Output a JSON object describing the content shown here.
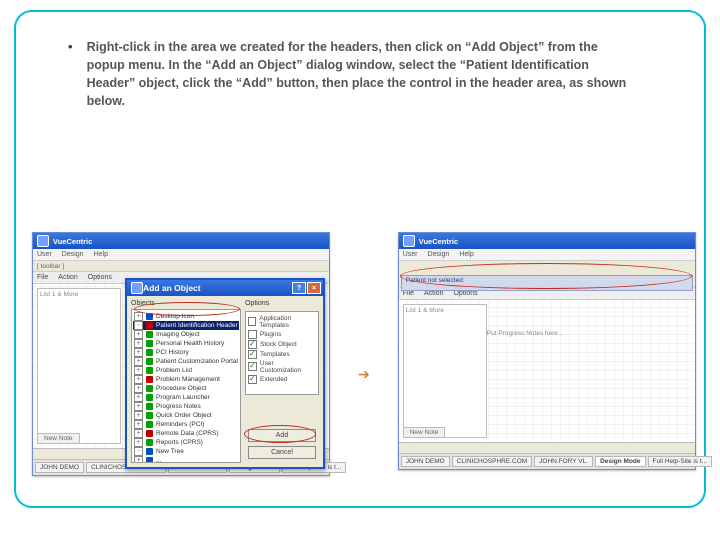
{
  "bullet": "•",
  "intro": "Right-click in the area we created for the headers, then click on “Add Object” from the popup menu.  In the “Add an Object” dialog window, select the “Patient Identification Header” object, click the “Add” button, then place the control in the header area, as shown below.",
  "arrow_glyph": "➔",
  "app_title": "VueCentric",
  "main_menu": {
    "0": "User",
    "1": "Design",
    "2": "Help"
  },
  "toolbar": {
    "0": "File",
    "1": "Action",
    "2": "Options"
  },
  "side_note": "List 1 & More",
  "tabs": {
    "0": "JOHN DEMO",
    "1": "CLINICHOSPHRE.COM",
    "2": "JOHN.FORY VL.",
    "3": "Design Mode",
    "4": "Full Help-Site is t..."
  },
  "dialog": {
    "title": "Add an Object",
    "section_objects": "Objects",
    "items": [
      {
        "pm": "+",
        "cls": "ib",
        "label": "Desktop Icon"
      },
      {
        "pm": "-",
        "cls": "ir",
        "label": "Patient Identification Header",
        "sel": true
      },
      {
        "pm": "+",
        "cls": "ig",
        "label": "Imaging Object"
      },
      {
        "pm": "+",
        "cls": "ig",
        "label": "Personal Health History"
      },
      {
        "pm": "+",
        "cls": "ig",
        "label": "PCI History"
      },
      {
        "pm": "+",
        "cls": "ig",
        "label": "Patient Customization Portal"
      },
      {
        "pm": "+",
        "cls": "ig",
        "label": "Problem List"
      },
      {
        "pm": "+",
        "cls": "ir",
        "label": "Problem Management"
      },
      {
        "pm": "+",
        "cls": "ig",
        "label": "Procedure Object"
      },
      {
        "pm": "+",
        "cls": "ig",
        "label": "Program Launcher"
      },
      {
        "pm": "+",
        "cls": "ig",
        "label": "Progress Notes"
      },
      {
        "pm": "+",
        "cls": "ig",
        "label": "Quick Order Object"
      },
      {
        "pm": "+",
        "cls": "ig",
        "label": "Reminders (PCI)"
      },
      {
        "pm": "+",
        "cls": "ir",
        "label": "Remote Data (CPRS)"
      },
      {
        "pm": "+",
        "cls": "ig",
        "label": "Reports (CPRS)"
      },
      {
        "pm": "-",
        "cls": "ib",
        "label": "New Tree"
      },
      {
        "pm": "+",
        "cls": "ib",
        "label": "..."
      }
    ],
    "section_options": "Options",
    "options": [
      {
        "on": false,
        "label": "Application Templates"
      },
      {
        "on": false,
        "label": "Plugins"
      },
      {
        "on": true,
        "label": "Stock Object"
      },
      {
        "on": true,
        "label": "Templates"
      },
      {
        "on": true,
        "label": "User Customization"
      },
      {
        "on": true,
        "label": "Extended"
      }
    ],
    "buttons": {
      "add": "Add",
      "cancel": "Cancel"
    }
  },
  "right_shot": {
    "header_label": "Patient not selected",
    "hint": "Put Progress Notes here...",
    "new_note": "New Note"
  }
}
